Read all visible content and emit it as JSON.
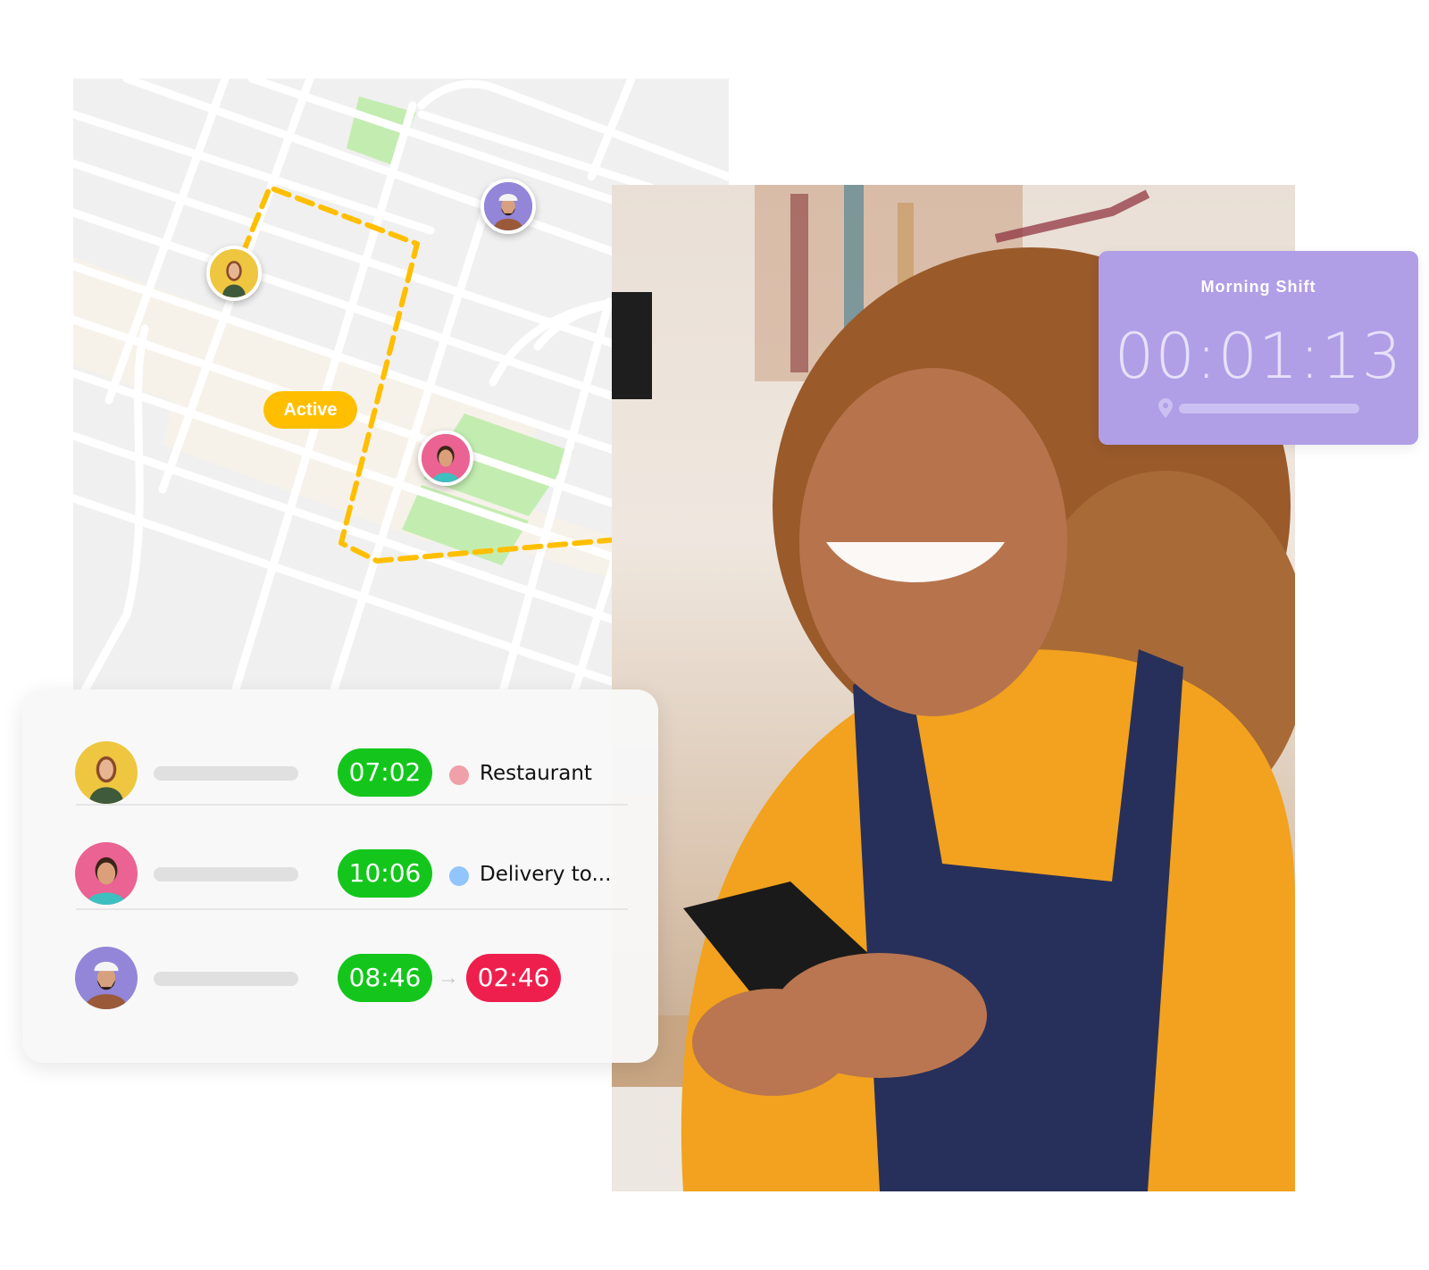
{
  "map": {
    "active_label": "Active",
    "colors": {
      "route": "#ffbf00",
      "park": "#c3edb0",
      "road": "#ffffff",
      "ground": "#f0f0f0",
      "zone": "#f6f2ea"
    },
    "markers": [
      {
        "person": "woman-yellow-bg",
        "status": "Active"
      },
      {
        "person": "man-hardhat-purple-bg"
      },
      {
        "person": "woman-pink-bg"
      }
    ]
  },
  "shift_card": {
    "title": "Morning Shift",
    "timer": "00:01:13",
    "icon": "location-pin-icon",
    "color": "#b09ee7"
  },
  "timesheet": {
    "rows": [
      {
        "person": "woman-yellow-bg",
        "clock_in": "07:02",
        "location_dot_color": "#f0a0a8",
        "location": "Restaurant"
      },
      {
        "person": "woman-pink-bg",
        "clock_in": "10:06",
        "location_dot_color": "#92c5fc",
        "location": "Delivery to..."
      },
      {
        "person": "man-hardhat-purple-bg",
        "clock_in": "08:46",
        "arrow": "→",
        "clock_out": "02:46"
      }
    ],
    "colors": {
      "clock_in": "#14c61c",
      "clock_out": "#ef1f4d"
    }
  },
  "photo": {
    "subject": "smiling woman in orange sweater and navy apron holding a smartphone in a workshop"
  }
}
